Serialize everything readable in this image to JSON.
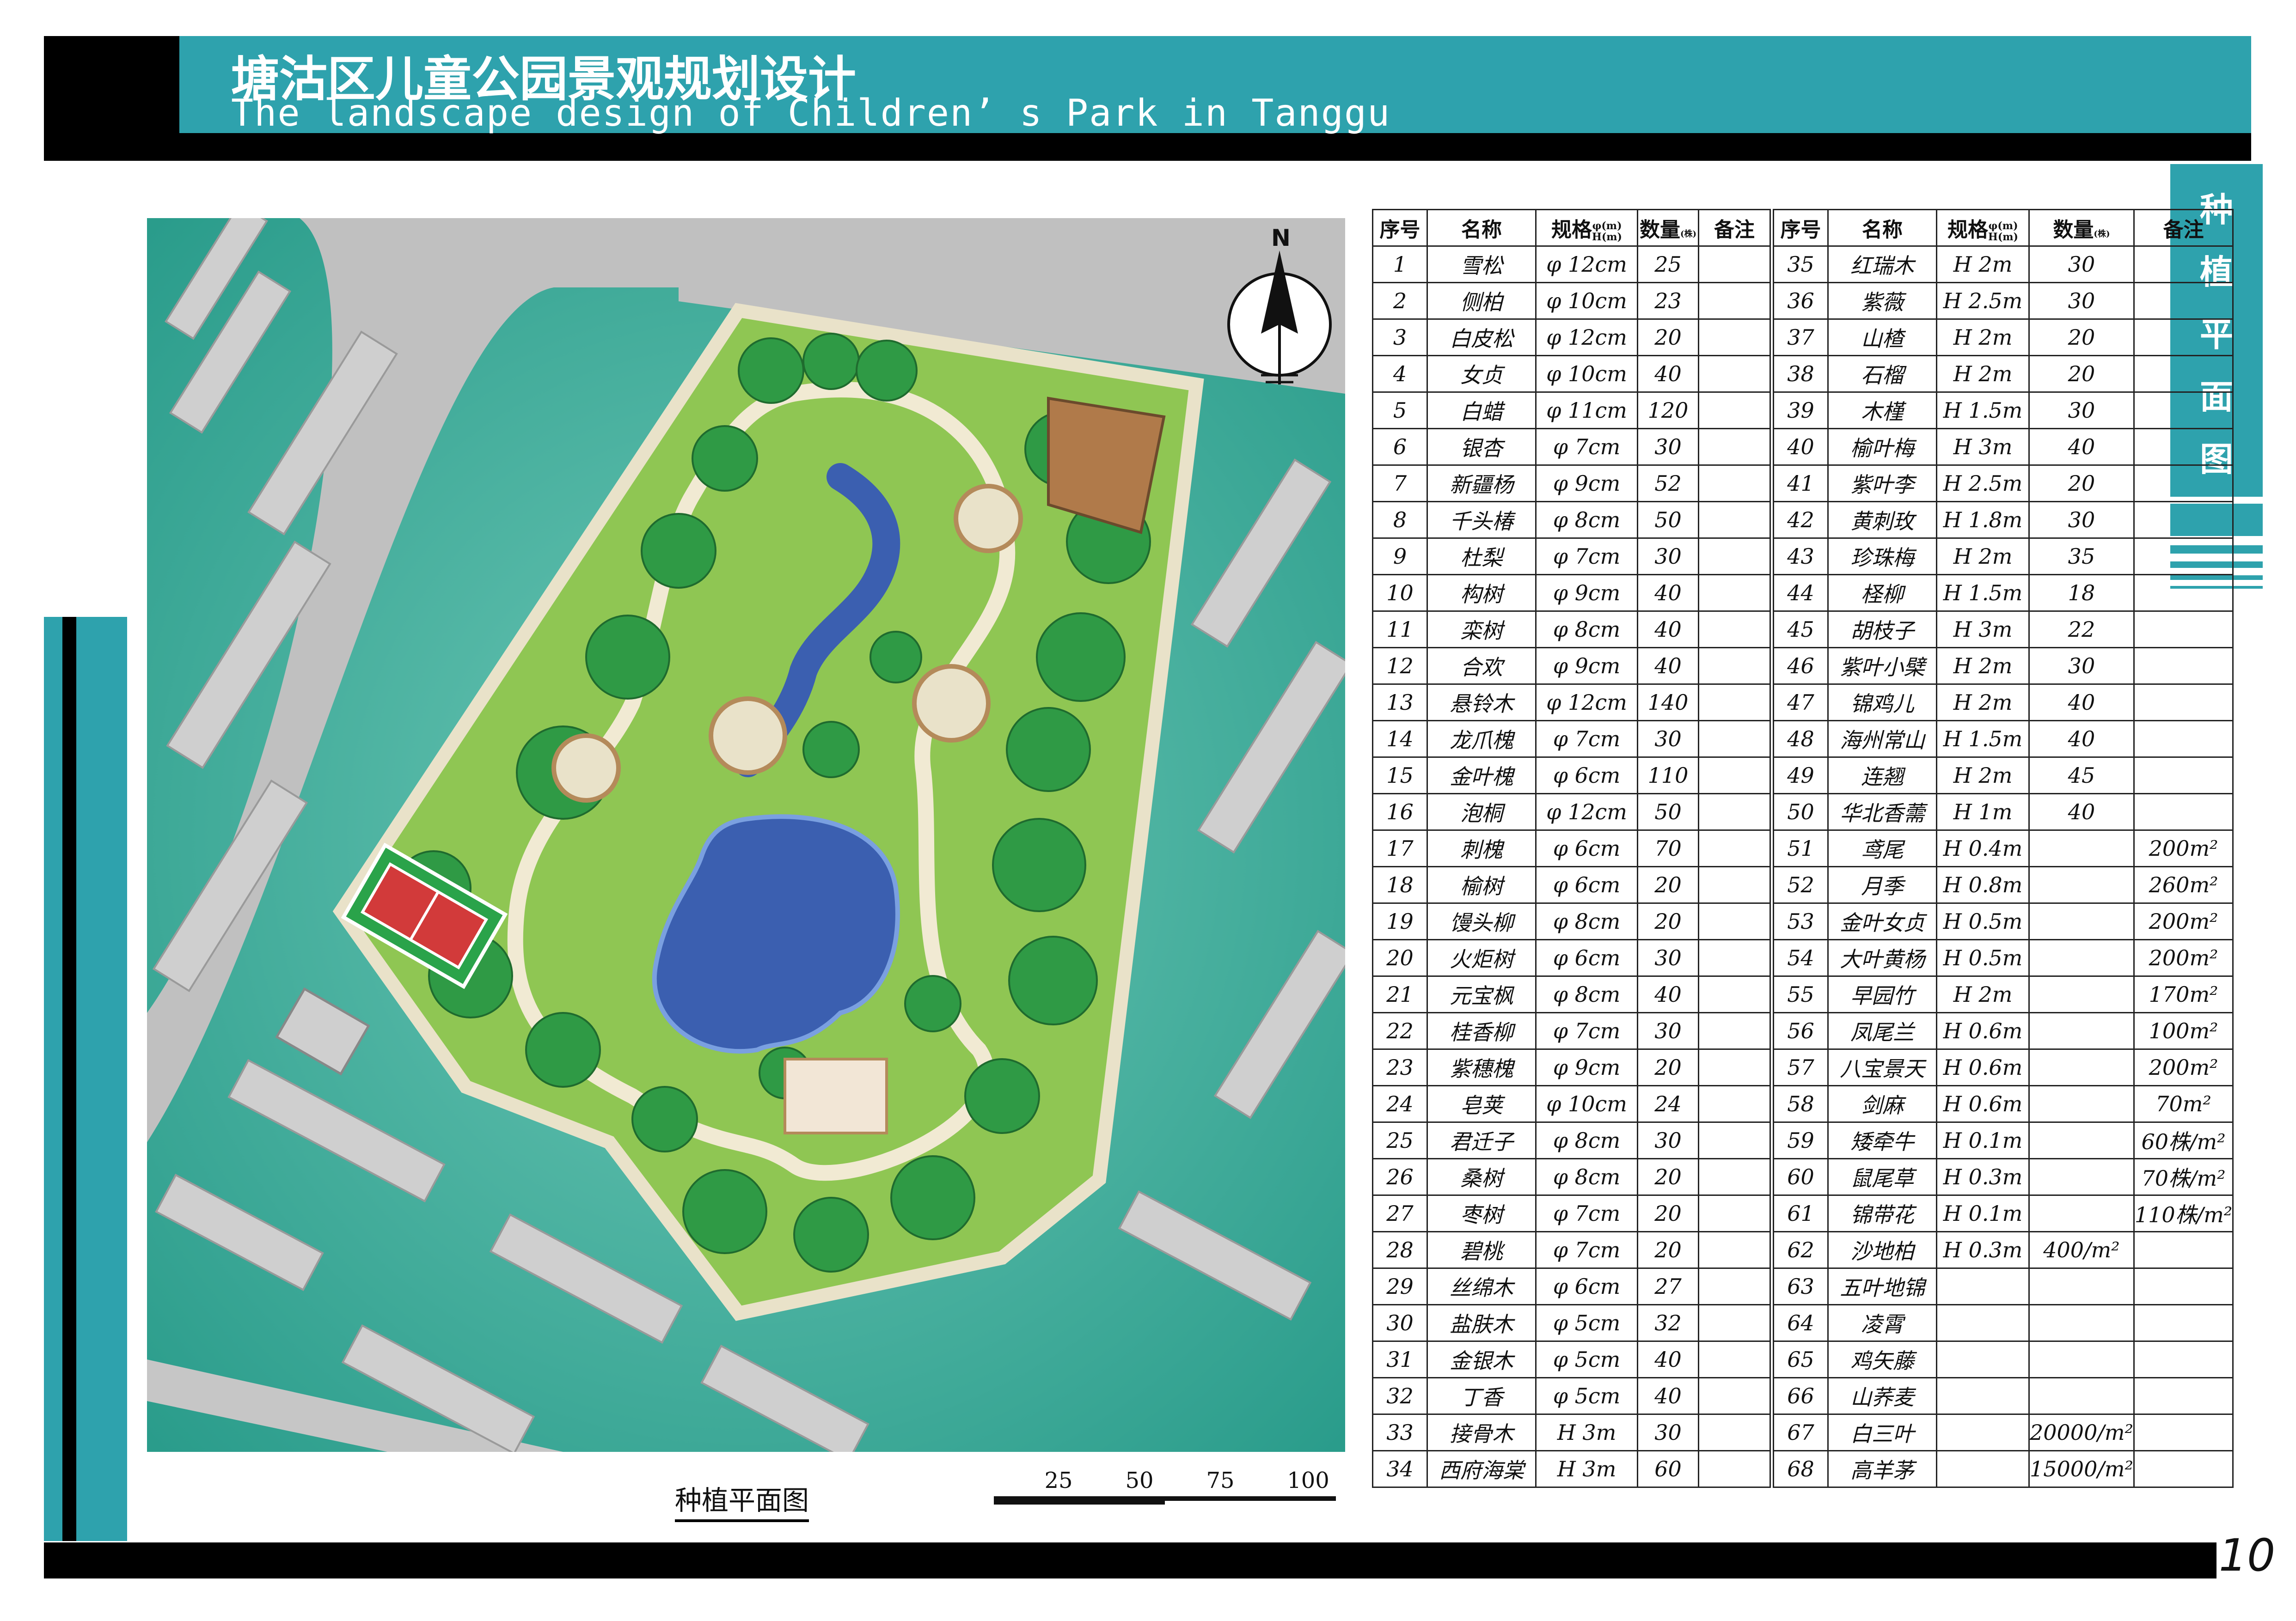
{
  "header": {
    "title_cn": "塘沽区儿童公园景观规划设计",
    "title_en": "The landscape design of Children’ s Park in Tanggu"
  },
  "side_title": [
    "种",
    "植",
    "平",
    "面",
    "图"
  ],
  "page_number": "10",
  "map": {
    "caption": "种植平面图",
    "north_label": "N",
    "scale_labels": [
      "25",
      "50",
      "75",
      "100"
    ],
    "colors": {
      "ground": "#2f9d8c",
      "road": "#bdbdbd",
      "building": "#c9c9c9",
      "park_lawn": "#8fc653",
      "tree": "#2f9a45",
      "path": "#e9e2c9",
      "water": "#3b5fb0",
      "court": "#d23a3a",
      "court_surround": "#2aa34a"
    }
  },
  "table": {
    "headers": {
      "no": "序号",
      "name": "名称",
      "spec": "规格",
      "spec_sub_top": "φ(m)",
      "spec_sub_bottom": "H(m)",
      "qty": "数量",
      "qty_sub": "(株)",
      "note": "备注"
    },
    "left_rows": [
      {
        "no": "1",
        "name": "雪松",
        "spec": "φ 12cm",
        "qty": "25",
        "note": ""
      },
      {
        "no": "2",
        "name": "侧柏",
        "spec": "φ 10cm",
        "qty": "23",
        "note": ""
      },
      {
        "no": "3",
        "name": "白皮松",
        "spec": "φ 12cm",
        "qty": "20",
        "note": ""
      },
      {
        "no": "4",
        "name": "女贞",
        "spec": "φ 10cm",
        "qty": "40",
        "note": ""
      },
      {
        "no": "5",
        "name": "白蜡",
        "spec": "φ 11cm",
        "qty": "120",
        "note": ""
      },
      {
        "no": "6",
        "name": "银杏",
        "spec": "φ 7cm",
        "qty": "30",
        "note": ""
      },
      {
        "no": "7",
        "name": "新疆杨",
        "spec": "φ 9cm",
        "qty": "52",
        "note": ""
      },
      {
        "no": "8",
        "name": "千头椿",
        "spec": "φ 8cm",
        "qty": "50",
        "note": ""
      },
      {
        "no": "9",
        "name": "杜梨",
        "spec": "φ 7cm",
        "qty": "30",
        "note": ""
      },
      {
        "no": "10",
        "name": "构树",
        "spec": "φ 9cm",
        "qty": "40",
        "note": ""
      },
      {
        "no": "11",
        "name": "栾树",
        "spec": "φ 8cm",
        "qty": "40",
        "note": ""
      },
      {
        "no": "12",
        "name": "合欢",
        "spec": "φ 9cm",
        "qty": "40",
        "note": ""
      },
      {
        "no": "13",
        "name": "悬铃木",
        "spec": "φ 12cm",
        "qty": "140",
        "note": ""
      },
      {
        "no": "14",
        "name": "龙爪槐",
        "spec": "φ 7cm",
        "qty": "30",
        "note": ""
      },
      {
        "no": "15",
        "name": "金叶槐",
        "spec": "φ 6cm",
        "qty": "110",
        "note": ""
      },
      {
        "no": "16",
        "name": "泡桐",
        "spec": "φ 12cm",
        "qty": "50",
        "note": ""
      },
      {
        "no": "17",
        "name": "刺槐",
        "spec": "φ 6cm",
        "qty": "70",
        "note": ""
      },
      {
        "no": "18",
        "name": "榆树",
        "spec": "φ 6cm",
        "qty": "20",
        "note": ""
      },
      {
        "no": "19",
        "name": "馒头柳",
        "spec": "φ 8cm",
        "qty": "20",
        "note": ""
      },
      {
        "no": "20",
        "name": "火炬树",
        "spec": "φ 6cm",
        "qty": "30",
        "note": ""
      },
      {
        "no": "21",
        "name": "元宝枫",
        "spec": "φ 8cm",
        "qty": "40",
        "note": ""
      },
      {
        "no": "22",
        "name": "桂香柳",
        "spec": "φ 7cm",
        "qty": "30",
        "note": ""
      },
      {
        "no": "23",
        "name": "紫穗槐",
        "spec": "φ 9cm",
        "qty": "20",
        "note": ""
      },
      {
        "no": "24",
        "name": "皂荚",
        "spec": "φ 10cm",
        "qty": "24",
        "note": ""
      },
      {
        "no": "25",
        "name": "君迁子",
        "spec": "φ 8cm",
        "qty": "30",
        "note": ""
      },
      {
        "no": "26",
        "name": "桑树",
        "spec": "φ 8cm",
        "qty": "20",
        "note": ""
      },
      {
        "no": "27",
        "name": "枣树",
        "spec": "φ 7cm",
        "qty": "20",
        "note": ""
      },
      {
        "no": "28",
        "name": "碧桃",
        "spec": "φ 7cm",
        "qty": "20",
        "note": ""
      },
      {
        "no": "29",
        "name": "丝绵木",
        "spec": "φ 6cm",
        "qty": "27",
        "note": ""
      },
      {
        "no": "30",
        "name": "盐肤木",
        "spec": "φ 5cm",
        "qty": "32",
        "note": ""
      },
      {
        "no": "31",
        "name": "金银木",
        "spec": "φ 5cm",
        "qty": "40",
        "note": ""
      },
      {
        "no": "32",
        "name": "丁香",
        "spec": "φ 5cm",
        "qty": "40",
        "note": ""
      },
      {
        "no": "33",
        "name": "接骨木",
        "spec": "H 3m",
        "qty": "30",
        "note": ""
      },
      {
        "no": "34",
        "name": "西府海棠",
        "spec": "H 3m",
        "qty": "60",
        "note": ""
      }
    ],
    "right_rows": [
      {
        "no": "35",
        "name": "红瑞木",
        "spec": "H 2m",
        "qty": "30",
        "note": ""
      },
      {
        "no": "36",
        "name": "紫薇",
        "spec": "H 2.5m",
        "qty": "30",
        "note": ""
      },
      {
        "no": "37",
        "name": "山楂",
        "spec": "H 2m",
        "qty": "20",
        "note": ""
      },
      {
        "no": "38",
        "name": "石榴",
        "spec": "H 2m",
        "qty": "20",
        "note": ""
      },
      {
        "no": "39",
        "name": "木槿",
        "spec": "H 1.5m",
        "qty": "30",
        "note": ""
      },
      {
        "no": "40",
        "name": "榆叶梅",
        "spec": "H 3m",
        "qty": "40",
        "note": ""
      },
      {
        "no": "41",
        "name": "紫叶李",
        "spec": "H 2.5m",
        "qty": "20",
        "note": ""
      },
      {
        "no": "42",
        "name": "黄刺玫",
        "spec": "H 1.8m",
        "qty": "30",
        "note": ""
      },
      {
        "no": "43",
        "name": "珍珠梅",
        "spec": "H 2m",
        "qty": "35",
        "note": ""
      },
      {
        "no": "44",
        "name": "柽柳",
        "spec": "H 1.5m",
        "qty": "18",
        "note": ""
      },
      {
        "no": "45",
        "name": "胡枝子",
        "spec": "H 3m",
        "qty": "22",
        "note": ""
      },
      {
        "no": "46",
        "name": "紫叶小檗",
        "spec": "H 2m",
        "qty": "30",
        "note": ""
      },
      {
        "no": "47",
        "name": "锦鸡儿",
        "spec": "H 2m",
        "qty": "40",
        "note": ""
      },
      {
        "no": "48",
        "name": "海州常山",
        "spec": "H 1.5m",
        "qty": "40",
        "note": ""
      },
      {
        "no": "49",
        "name": "连翘",
        "spec": "H 2m",
        "qty": "45",
        "note": ""
      },
      {
        "no": "50",
        "name": "华北香薷",
        "spec": "H 1m",
        "qty": "40",
        "note": ""
      },
      {
        "no": "51",
        "name": "鸢尾",
        "spec": "H 0.4m",
        "qty": "",
        "note": "200m²"
      },
      {
        "no": "52",
        "name": "月季",
        "spec": "H 0.8m",
        "qty": "",
        "note": "260m²"
      },
      {
        "no": "53",
        "name": "金叶女贞",
        "spec": "H 0.5m",
        "qty": "",
        "note": "200m²"
      },
      {
        "no": "54",
        "name": "大叶黄杨",
        "spec": "H 0.5m",
        "qty": "",
        "note": "200m²"
      },
      {
        "no": "55",
        "name": "早园竹",
        "spec": "H 2m",
        "qty": "",
        "note": "170m²"
      },
      {
        "no": "56",
        "name": "凤尾兰",
        "spec": "H 0.6m",
        "qty": "",
        "note": "100m²"
      },
      {
        "no": "57",
        "name": "八宝景天",
        "spec": "H 0.6m",
        "qty": "",
        "note": "200m²"
      },
      {
        "no": "58",
        "name": "剑麻",
        "spec": "H 0.6m",
        "qty": "",
        "note": "70m²"
      },
      {
        "no": "59",
        "name": "矮牵牛",
        "spec": "H 0.1m",
        "qty": "",
        "note": "60株/m²"
      },
      {
        "no": "60",
        "name": "鼠尾草",
        "spec": "H 0.3m",
        "qty": "",
        "note": "70株/m²"
      },
      {
        "no": "61",
        "name": "锦带花",
        "spec": "H 0.1m",
        "qty": "",
        "note": "110株/m²"
      },
      {
        "no": "62",
        "name": "沙地柏",
        "spec": "H 0.3m",
        "qty": "400/m²",
        "note": ""
      },
      {
        "no": "63",
        "name": "五叶地锦",
        "spec": "",
        "qty": "",
        "note": ""
      },
      {
        "no": "64",
        "name": "凌霄",
        "spec": "",
        "qty": "",
        "note": ""
      },
      {
        "no": "65",
        "name": "鸡矢藤",
        "spec": "",
        "qty": "",
        "note": ""
      },
      {
        "no": "66",
        "name": "山荞麦",
        "spec": "",
        "qty": "",
        "note": ""
      },
      {
        "no": "67",
        "name": "白三叶",
        "spec": "",
        "qty": "20000/m²",
        "note": ""
      },
      {
        "no": "68",
        "name": "高羊茅",
        "spec": "",
        "qty": "15000/m²",
        "note": ""
      }
    ]
  }
}
